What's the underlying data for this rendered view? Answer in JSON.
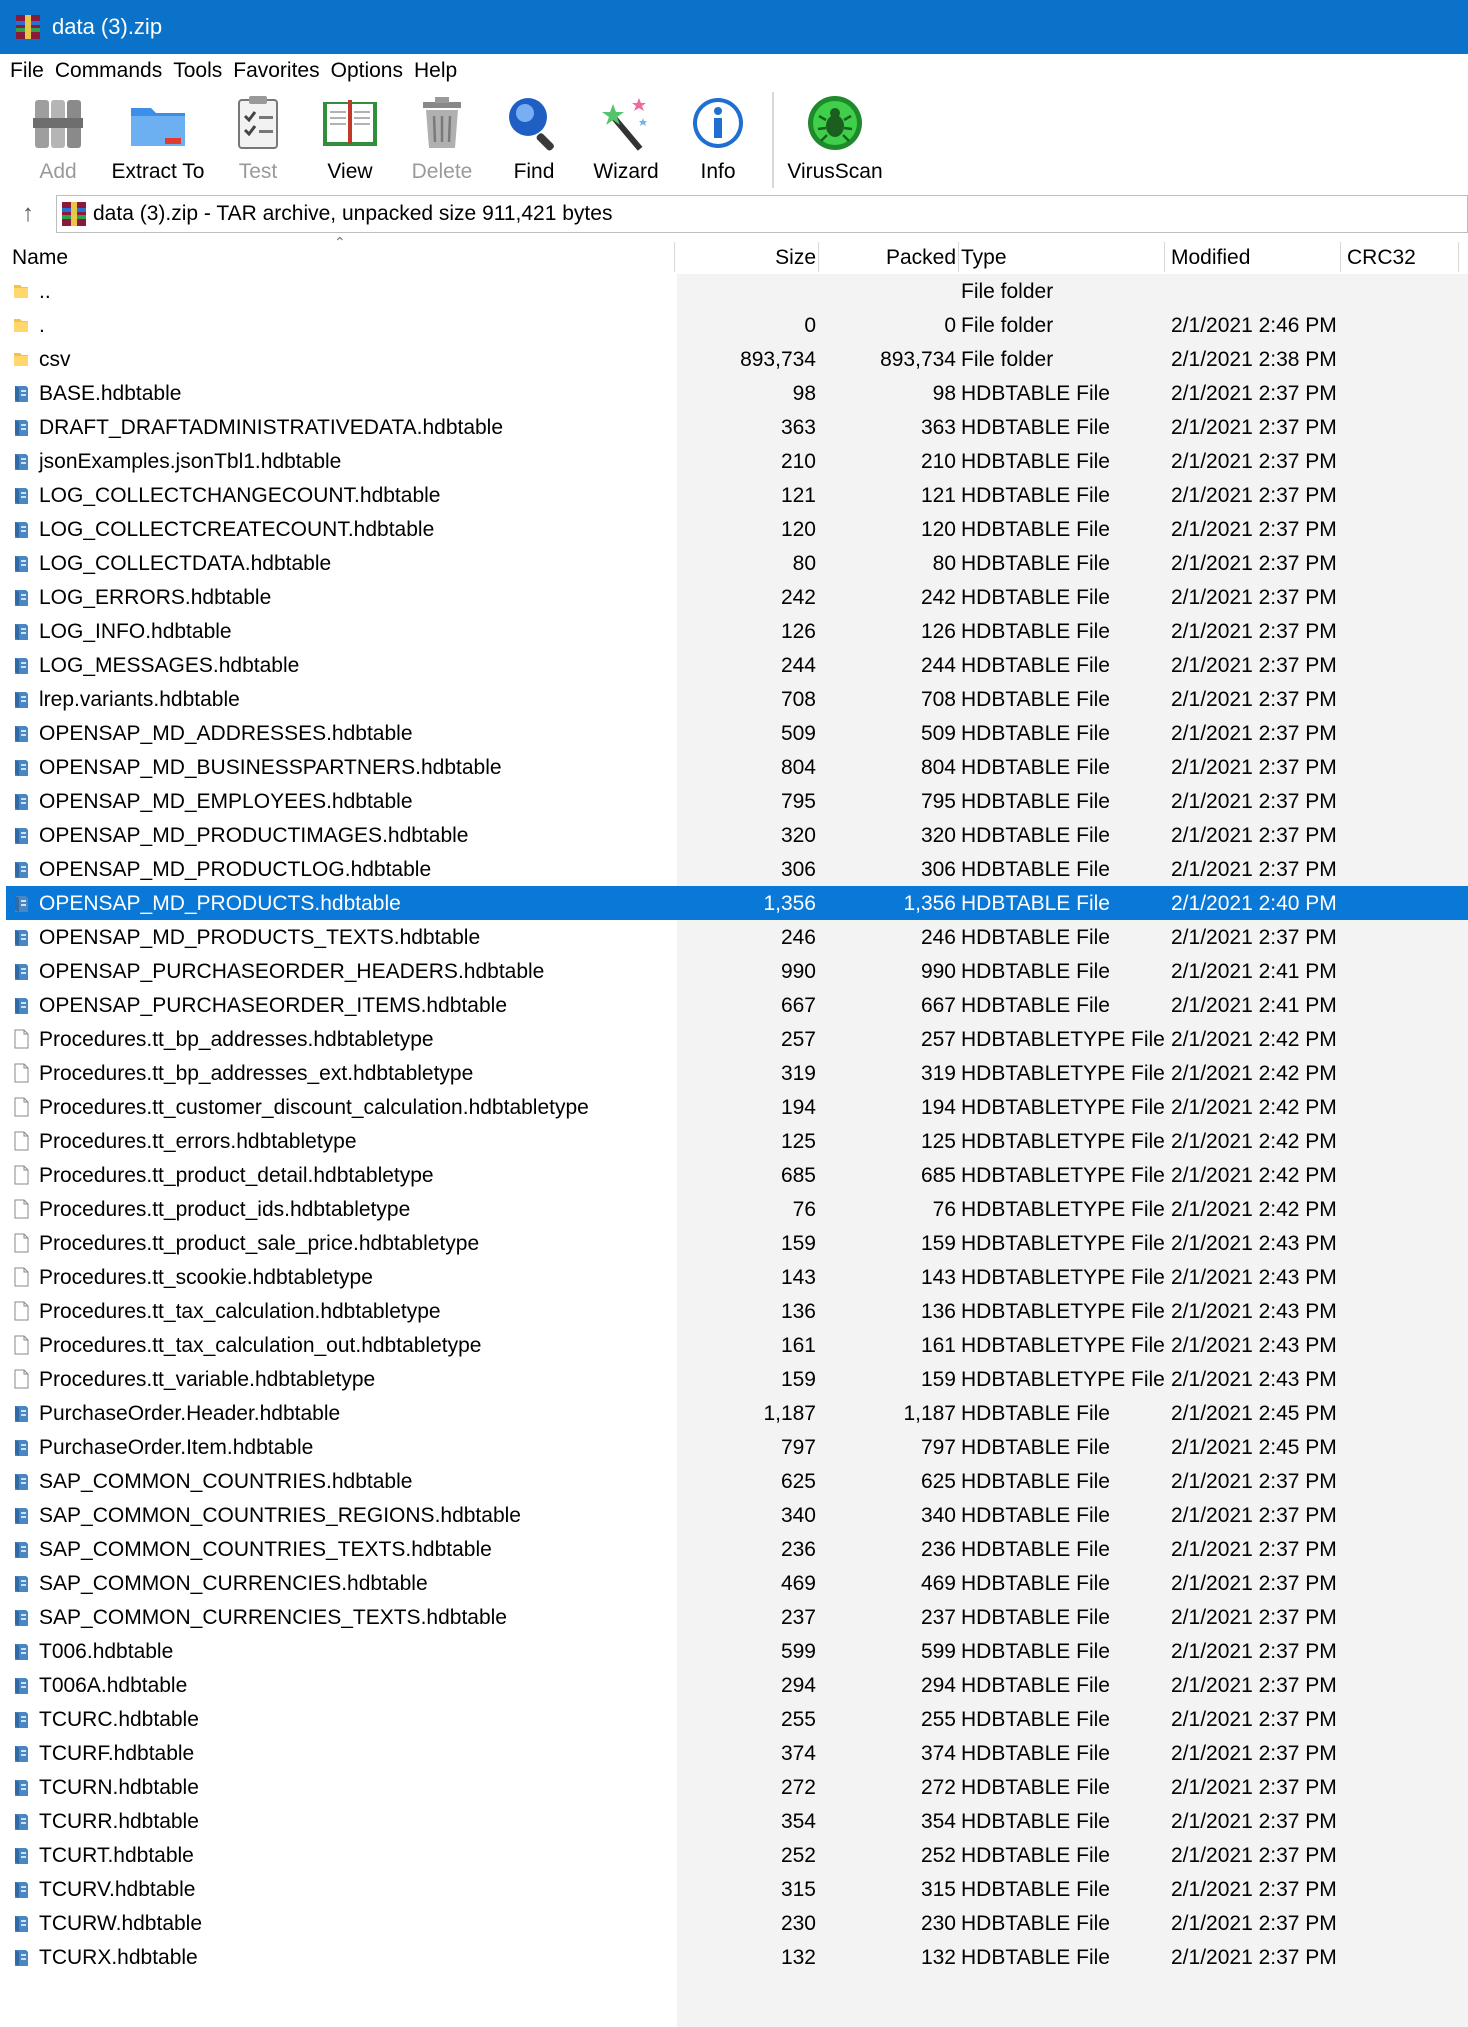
{
  "window": {
    "title": "data (3).zip"
  },
  "menu": [
    "File",
    "Commands",
    "Tools",
    "Favorites",
    "Options",
    "Help"
  ],
  "toolbar": [
    {
      "label": "Add",
      "icon": "add-icon",
      "enabled": false
    },
    {
      "label": "Extract To",
      "icon": "folder-icon",
      "enabled": true
    },
    {
      "label": "Test",
      "icon": "clipboard-check-icon",
      "enabled": false
    },
    {
      "label": "View",
      "icon": "book-icon",
      "enabled": true
    },
    {
      "label": "Delete",
      "icon": "trash-icon",
      "enabled": false
    },
    {
      "label": "Find",
      "icon": "magnifier-icon",
      "enabled": true
    },
    {
      "label": "Wizard",
      "icon": "magic-wand-icon",
      "enabled": true
    },
    {
      "label": "Info",
      "icon": "info-icon",
      "enabled": true
    },
    {
      "label": "VirusScan",
      "icon": "bug-icon",
      "enabled": true
    }
  ],
  "address": {
    "text": "data (3).zip - TAR archive, unpacked size 911,421 bytes"
  },
  "columns": {
    "name": "Name",
    "size": "Size",
    "packed": "Packed",
    "type": "Type",
    "modified": "Modified",
    "crc": "CRC32"
  },
  "files": [
    {
      "name": "..",
      "size": "",
      "packed": "",
      "type": "File folder",
      "modified": "",
      "icon": "folder"
    },
    {
      "name": ".",
      "size": "0",
      "packed": "0",
      "type": "File folder",
      "modified": "2/1/2021 2:46 PM",
      "icon": "folder"
    },
    {
      "name": "csv",
      "size": "893,734",
      "packed": "893,734",
      "type": "File folder",
      "modified": "2/1/2021 2:38 PM",
      "icon": "folder"
    },
    {
      "name": "BASE.hdbtable",
      "size": "98",
      "packed": "98",
      "type": "HDBTABLE File",
      "modified": "2/1/2021 2:37 PM",
      "icon": "hdb"
    },
    {
      "name": "DRAFT_DRAFTADMINISTRATIVEDATA.hdbtable",
      "size": "363",
      "packed": "363",
      "type": "HDBTABLE File",
      "modified": "2/1/2021 2:37 PM",
      "icon": "hdb"
    },
    {
      "name": "jsonExamples.jsonTbl1.hdbtable",
      "size": "210",
      "packed": "210",
      "type": "HDBTABLE File",
      "modified": "2/1/2021 2:37 PM",
      "icon": "hdb"
    },
    {
      "name": "LOG_COLLECTCHANGECOUNT.hdbtable",
      "size": "121",
      "packed": "121",
      "type": "HDBTABLE File",
      "modified": "2/1/2021 2:37 PM",
      "icon": "hdb"
    },
    {
      "name": "LOG_COLLECTCREATECOUNT.hdbtable",
      "size": "120",
      "packed": "120",
      "type": "HDBTABLE File",
      "modified": "2/1/2021 2:37 PM",
      "icon": "hdb"
    },
    {
      "name": "LOG_COLLECTDATA.hdbtable",
      "size": "80",
      "packed": "80",
      "type": "HDBTABLE File",
      "modified": "2/1/2021 2:37 PM",
      "icon": "hdb"
    },
    {
      "name": "LOG_ERRORS.hdbtable",
      "size": "242",
      "packed": "242",
      "type": "HDBTABLE File",
      "modified": "2/1/2021 2:37 PM",
      "icon": "hdb"
    },
    {
      "name": "LOG_INFO.hdbtable",
      "size": "126",
      "packed": "126",
      "type": "HDBTABLE File",
      "modified": "2/1/2021 2:37 PM",
      "icon": "hdb"
    },
    {
      "name": "LOG_MESSAGES.hdbtable",
      "size": "244",
      "packed": "244",
      "type": "HDBTABLE File",
      "modified": "2/1/2021 2:37 PM",
      "icon": "hdb"
    },
    {
      "name": "lrep.variants.hdbtable",
      "size": "708",
      "packed": "708",
      "type": "HDBTABLE File",
      "modified": "2/1/2021 2:37 PM",
      "icon": "hdb"
    },
    {
      "name": "OPENSAP_MD_ADDRESSES.hdbtable",
      "size": "509",
      "packed": "509",
      "type": "HDBTABLE File",
      "modified": "2/1/2021 2:37 PM",
      "icon": "hdb"
    },
    {
      "name": "OPENSAP_MD_BUSINESSPARTNERS.hdbtable",
      "size": "804",
      "packed": "804",
      "type": "HDBTABLE File",
      "modified": "2/1/2021 2:37 PM",
      "icon": "hdb"
    },
    {
      "name": "OPENSAP_MD_EMPLOYEES.hdbtable",
      "size": "795",
      "packed": "795",
      "type": "HDBTABLE File",
      "modified": "2/1/2021 2:37 PM",
      "icon": "hdb"
    },
    {
      "name": "OPENSAP_MD_PRODUCTIMAGES.hdbtable",
      "size": "320",
      "packed": "320",
      "type": "HDBTABLE File",
      "modified": "2/1/2021 2:37 PM",
      "icon": "hdb"
    },
    {
      "name": "OPENSAP_MD_PRODUCTLOG.hdbtable",
      "size": "306",
      "packed": "306",
      "type": "HDBTABLE File",
      "modified": "2/1/2021 2:37 PM",
      "icon": "hdb"
    },
    {
      "name": "OPENSAP_MD_PRODUCTS.hdbtable",
      "size": "1,356",
      "packed": "1,356",
      "type": "HDBTABLE File",
      "modified": "2/1/2021 2:40 PM",
      "icon": "hdb",
      "selected": true
    },
    {
      "name": "OPENSAP_MD_PRODUCTS_TEXTS.hdbtable",
      "size": "246",
      "packed": "246",
      "type": "HDBTABLE File",
      "modified": "2/1/2021 2:37 PM",
      "icon": "hdb"
    },
    {
      "name": "OPENSAP_PURCHASEORDER_HEADERS.hdbtable",
      "size": "990",
      "packed": "990",
      "type": "HDBTABLE File",
      "modified": "2/1/2021 2:41 PM",
      "icon": "hdb"
    },
    {
      "name": "OPENSAP_PURCHASEORDER_ITEMS.hdbtable",
      "size": "667",
      "packed": "667",
      "type": "HDBTABLE File",
      "modified": "2/1/2021 2:41 PM",
      "icon": "hdb"
    },
    {
      "name": "Procedures.tt_bp_addresses.hdbtabletype",
      "size": "257",
      "packed": "257",
      "type": "HDBTABLETYPE File",
      "modified": "2/1/2021 2:42 PM",
      "icon": "doc"
    },
    {
      "name": "Procedures.tt_bp_addresses_ext.hdbtabletype",
      "size": "319",
      "packed": "319",
      "type": "HDBTABLETYPE File",
      "modified": "2/1/2021 2:42 PM",
      "icon": "doc"
    },
    {
      "name": "Procedures.tt_customer_discount_calculation.hdbtabletype",
      "size": "194",
      "packed": "194",
      "type": "HDBTABLETYPE File",
      "modified": "2/1/2021 2:42 PM",
      "icon": "doc"
    },
    {
      "name": "Procedures.tt_errors.hdbtabletype",
      "size": "125",
      "packed": "125",
      "type": "HDBTABLETYPE File",
      "modified": "2/1/2021 2:42 PM",
      "icon": "doc"
    },
    {
      "name": "Procedures.tt_product_detail.hdbtabletype",
      "size": "685",
      "packed": "685",
      "type": "HDBTABLETYPE File",
      "modified": "2/1/2021 2:42 PM",
      "icon": "doc"
    },
    {
      "name": "Procedures.tt_product_ids.hdbtabletype",
      "size": "76",
      "packed": "76",
      "type": "HDBTABLETYPE File",
      "modified": "2/1/2021 2:42 PM",
      "icon": "doc"
    },
    {
      "name": "Procedures.tt_product_sale_price.hdbtabletype",
      "size": "159",
      "packed": "159",
      "type": "HDBTABLETYPE File",
      "modified": "2/1/2021 2:43 PM",
      "icon": "doc"
    },
    {
      "name": "Procedures.tt_scookie.hdbtabletype",
      "size": "143",
      "packed": "143",
      "type": "HDBTABLETYPE File",
      "modified": "2/1/2021 2:43 PM",
      "icon": "doc"
    },
    {
      "name": "Procedures.tt_tax_calculation.hdbtabletype",
      "size": "136",
      "packed": "136",
      "type": "HDBTABLETYPE File",
      "modified": "2/1/2021 2:43 PM",
      "icon": "doc"
    },
    {
      "name": "Procedures.tt_tax_calculation_out.hdbtabletype",
      "size": "161",
      "packed": "161",
      "type": "HDBTABLETYPE File",
      "modified": "2/1/2021 2:43 PM",
      "icon": "doc"
    },
    {
      "name": "Procedures.tt_variable.hdbtabletype",
      "size": "159",
      "packed": "159",
      "type": "HDBTABLETYPE File",
      "modified": "2/1/2021 2:43 PM",
      "icon": "doc"
    },
    {
      "name": "PurchaseOrder.Header.hdbtable",
      "size": "1,187",
      "packed": "1,187",
      "type": "HDBTABLE File",
      "modified": "2/1/2021 2:45 PM",
      "icon": "hdb"
    },
    {
      "name": "PurchaseOrder.Item.hdbtable",
      "size": "797",
      "packed": "797",
      "type": "HDBTABLE File",
      "modified": "2/1/2021 2:45 PM",
      "icon": "hdb"
    },
    {
      "name": "SAP_COMMON_COUNTRIES.hdbtable",
      "size": "625",
      "packed": "625",
      "type": "HDBTABLE File",
      "modified": "2/1/2021 2:37 PM",
      "icon": "hdb"
    },
    {
      "name": "SAP_COMMON_COUNTRIES_REGIONS.hdbtable",
      "size": "340",
      "packed": "340",
      "type": "HDBTABLE File",
      "modified": "2/1/2021 2:37 PM",
      "icon": "hdb"
    },
    {
      "name": "SAP_COMMON_COUNTRIES_TEXTS.hdbtable",
      "size": "236",
      "packed": "236",
      "type": "HDBTABLE File",
      "modified": "2/1/2021 2:37 PM",
      "icon": "hdb"
    },
    {
      "name": "SAP_COMMON_CURRENCIES.hdbtable",
      "size": "469",
      "packed": "469",
      "type": "HDBTABLE File",
      "modified": "2/1/2021 2:37 PM",
      "icon": "hdb"
    },
    {
      "name": "SAP_COMMON_CURRENCIES_TEXTS.hdbtable",
      "size": "237",
      "packed": "237",
      "type": "HDBTABLE File",
      "modified": "2/1/2021 2:37 PM",
      "icon": "hdb"
    },
    {
      "name": "T006.hdbtable",
      "size": "599",
      "packed": "599",
      "type": "HDBTABLE File",
      "modified": "2/1/2021 2:37 PM",
      "icon": "hdb"
    },
    {
      "name": "T006A.hdbtable",
      "size": "294",
      "packed": "294",
      "type": "HDBTABLE File",
      "modified": "2/1/2021 2:37 PM",
      "icon": "hdb"
    },
    {
      "name": "TCURC.hdbtable",
      "size": "255",
      "packed": "255",
      "type": "HDBTABLE File",
      "modified": "2/1/2021 2:37 PM",
      "icon": "hdb"
    },
    {
      "name": "TCURF.hdbtable",
      "size": "374",
      "packed": "374",
      "type": "HDBTABLE File",
      "modified": "2/1/2021 2:37 PM",
      "icon": "hdb"
    },
    {
      "name": "TCURN.hdbtable",
      "size": "272",
      "packed": "272",
      "type": "HDBTABLE File",
      "modified": "2/1/2021 2:37 PM",
      "icon": "hdb"
    },
    {
      "name": "TCURR.hdbtable",
      "size": "354",
      "packed": "354",
      "type": "HDBTABLE File",
      "modified": "2/1/2021 2:37 PM",
      "icon": "hdb"
    },
    {
      "name": "TCURT.hdbtable",
      "size": "252",
      "packed": "252",
      "type": "HDBTABLE File",
      "modified": "2/1/2021 2:37 PM",
      "icon": "hdb"
    },
    {
      "name": "TCURV.hdbtable",
      "size": "315",
      "packed": "315",
      "type": "HDBTABLE File",
      "modified": "2/1/2021 2:37 PM",
      "icon": "hdb"
    },
    {
      "name": "TCURW.hdbtable",
      "size": "230",
      "packed": "230",
      "type": "HDBTABLE File",
      "modified": "2/1/2021 2:37 PM",
      "icon": "hdb"
    },
    {
      "name": "TCURX.hdbtable",
      "size": "132",
      "packed": "132",
      "type": "HDBTABLE File",
      "modified": "2/1/2021 2:37 PM",
      "icon": "hdb"
    }
  ],
  "colors": {
    "titlebar": "#0a72c9",
    "selection": "#0a78d7",
    "folder": "#f5c342",
    "hdb_icon": "#4a87c2"
  }
}
